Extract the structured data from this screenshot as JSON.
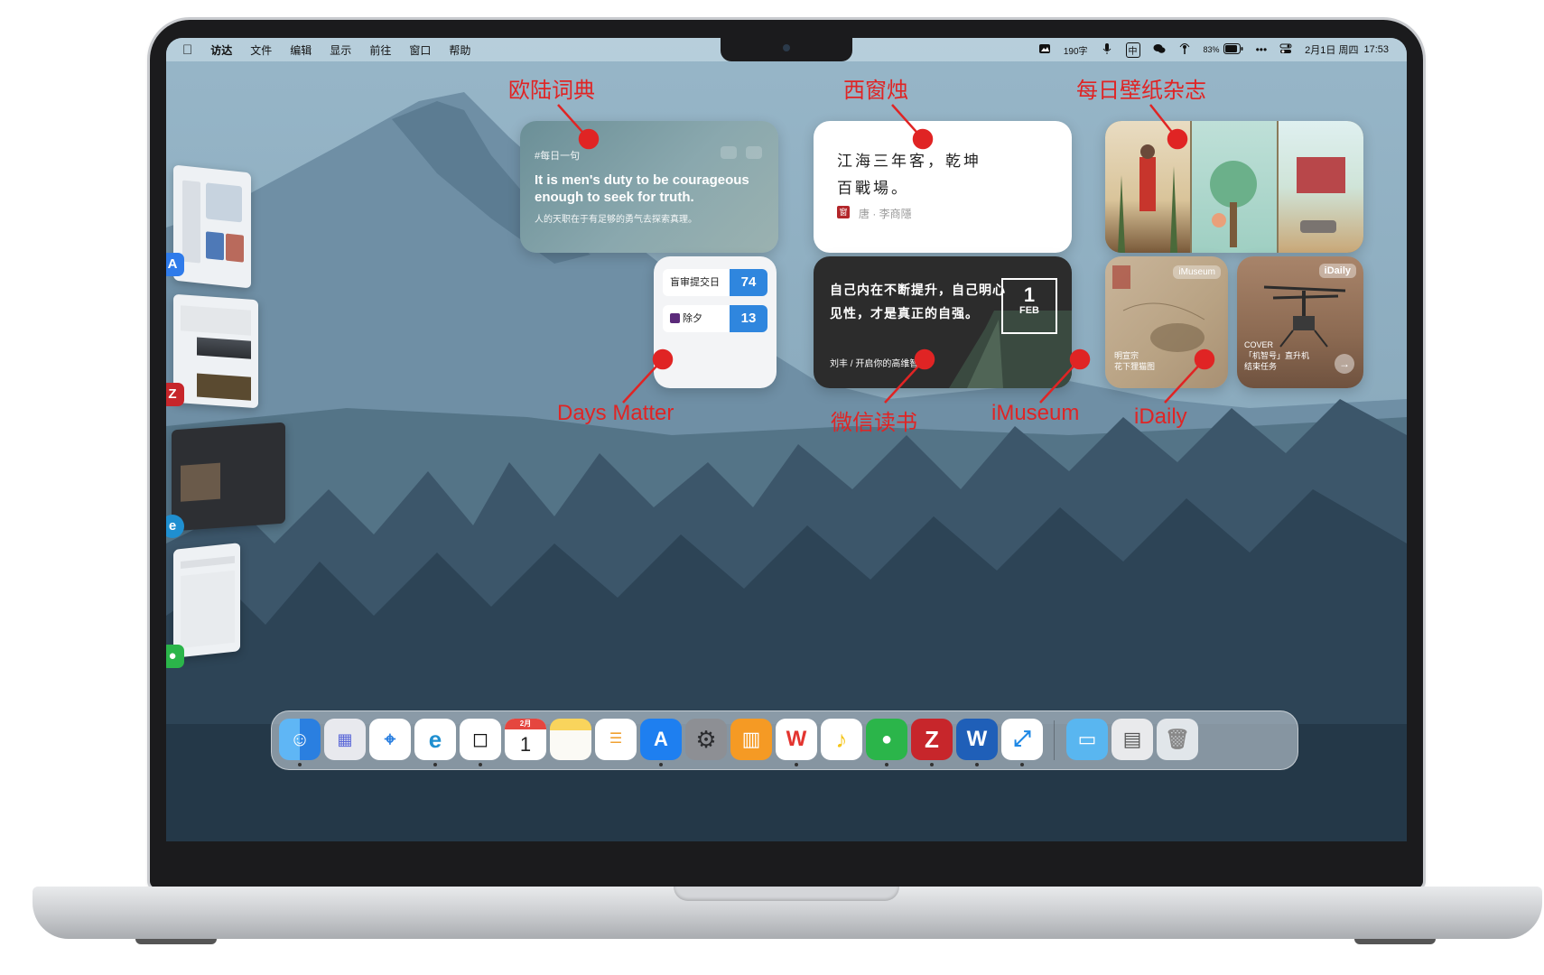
{
  "menubar": {
    "apple": "",
    "items": [
      "访达",
      "文件",
      "编辑",
      "显示",
      "前往",
      "窗口",
      "帮助"
    ],
    "word_count": "190字",
    "input_method": "中",
    "battery": "83%",
    "more": "•••",
    "date": "2月1日 周四",
    "time": "17:53"
  },
  "annotations": {
    "dict": "欧陆词典",
    "poem": "西窗烛",
    "wallpaper": "每日壁纸杂志",
    "days": "Days Matter",
    "reading": "微信读书",
    "museum": "iMuseum",
    "daily": "iDaily"
  },
  "widgets": {
    "dict": {
      "tag": "#每日一句",
      "en": "It is men's duty to be courageous enough to seek for truth.",
      "zh": "人的天职在于有足够的勇气去探索真理。"
    },
    "poem": {
      "line1": "江海三年客，乾坤",
      "line2": "百戰場。",
      "seal": "窗",
      "author": "唐 · 李商隱"
    },
    "days": {
      "items": [
        {
          "name": "盲审提交日",
          "value": "74"
        },
        {
          "name": "除夕",
          "value": "13"
        }
      ]
    },
    "reading": {
      "quote": "自己内在不断提升，自己明心见性，才是真正的自强。",
      "source": "刘丰 / 开启你的高维智慧",
      "day": "1",
      "month": "FEB"
    },
    "museum": {
      "badge": "iMuseum",
      "caption_1": "明宣宗",
      "caption_2": "花下狸猫图"
    },
    "daily": {
      "badge": "iDaily",
      "caption_1": "COVER",
      "caption_2": "「机智号」直升机",
      "caption_3": "结束任务",
      "go": "→"
    }
  },
  "dock": {
    "calendar_month": "2月",
    "calendar_day": "1"
  },
  "colors": {
    "annotation": "#e02424",
    "days_accent": "#2f86de"
  }
}
